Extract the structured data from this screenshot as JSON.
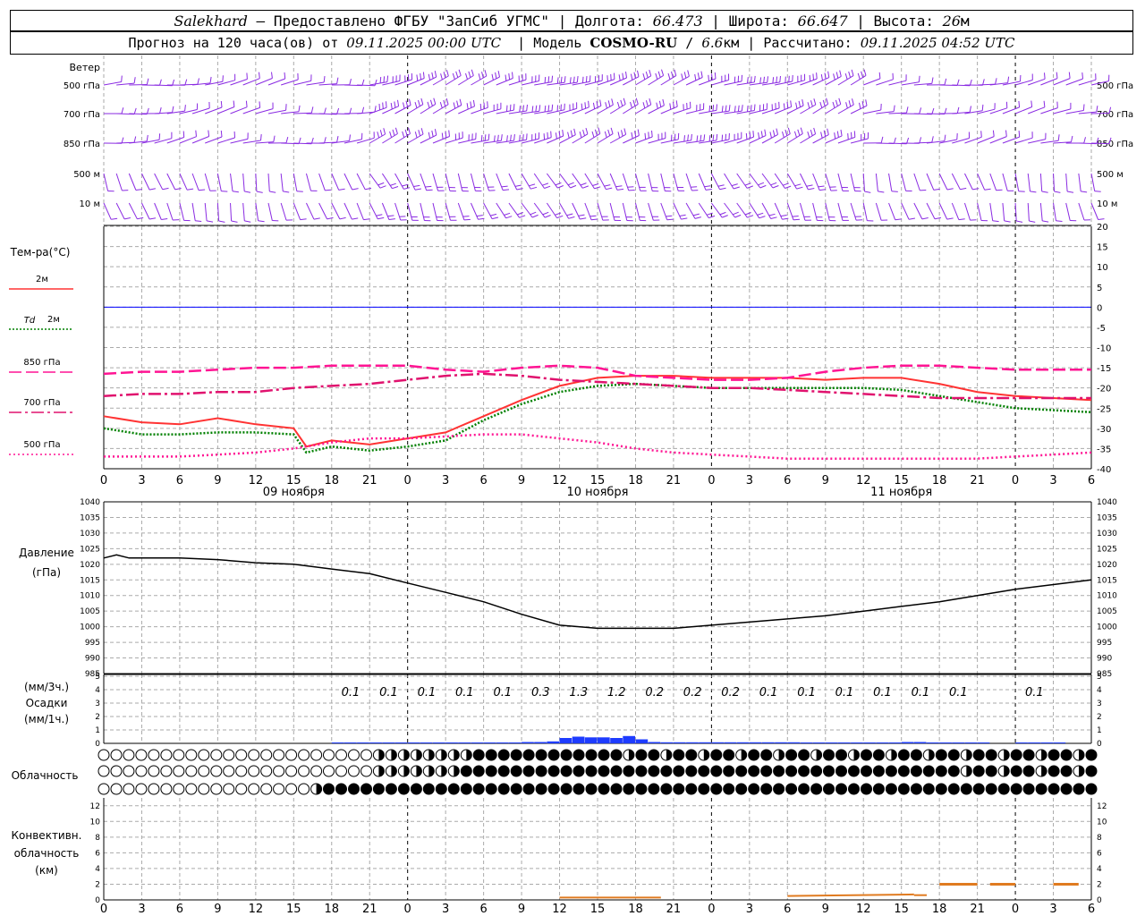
{
  "header": {
    "station": "Salekhard",
    "provider": "– Предоставлено ФГБУ \"ЗапСиб УГМС\"",
    "lon_label": "Долгота:",
    "lon_value": "66.473",
    "lat_label": "Широта:",
    "lat_value": "66.647",
    "alt_label": "Высота:",
    "alt_value": "26",
    "alt_unit": "м",
    "forecast_label": "Прогноз на 120 часа(ов) от",
    "forecast_start": "09.11.2025 00:00 UTC",
    "model_label": "Модель",
    "model_name": "COSMO-RU",
    "model_res": "6.6",
    "model_unit": "км",
    "calc_label": "Рассчитано:",
    "calc_time": "09.11.2025 04:52 UTC"
  },
  "colors": {
    "wind": "#8a2be2",
    "t2m": "#ff3333",
    "td2m": "#008000",
    "t850": "#ff1493",
    "t700": "#e0126e",
    "t500": "#ff1493",
    "zero_line": "#0000ff",
    "pressure": "#000000",
    "precip": "#1e3cff",
    "convective": "#e07b20",
    "grid": "#aaaaaa"
  },
  "chart_data": [
    {
      "type": "wind_barbs",
      "row_labels": [
        "Ветер",
        "500 гПа",
        "700 гПа",
        "850 гПа",
        "500 м",
        "10 м"
      ],
      "levels": [
        "500 гПа",
        "700 гПа",
        "850 гПа",
        "500 м",
        "10 м"
      ]
    },
    {
      "type": "line",
      "ylabel": "Тем-ра(°C)",
      "ylim": [
        -40,
        20
      ],
      "yticks": [
        -40,
        -35,
        -30,
        -25,
        -20,
        -15,
        -10,
        -5,
        0,
        5,
        10,
        15,
        20
      ],
      "xticks": [
        "0",
        "3",
        "6",
        "9",
        "12",
        "15",
        "18",
        "21",
        "0",
        "3",
        "6",
        "9",
        "12",
        "15",
        "18",
        "21",
        "0",
        "3",
        "6",
        "9",
        "12",
        "15",
        "18",
        "21",
        "0",
        "3",
        "6"
      ],
      "day_labels": [
        "09 ноября",
        "10 ноября",
        "11 ноября"
      ],
      "day_label_hours": [
        15,
        39,
        63
      ],
      "series": [
        {
          "name": "2м",
          "color": "#ff3333",
          "style": "solid",
          "x": [
            0,
            3,
            6,
            9,
            12,
            15,
            16,
            18,
            21,
            24,
            27,
            30,
            33,
            36,
            39,
            42,
            45,
            48,
            51,
            54,
            57,
            60,
            63,
            66,
            69,
            72,
            75,
            78
          ],
          "values": [
            -27,
            -28.5,
            -29,
            -27.5,
            -29,
            -30,
            -34.5,
            -33,
            -34,
            -32.5,
            -31,
            -27,
            -23,
            -19.5,
            -17.5,
            -17,
            -17,
            -17.5,
            -17.5,
            -17.5,
            -18,
            -17.5,
            -17.5,
            -19,
            -21,
            -22,
            -22.5,
            -23
          ]
        },
        {
          "name": "Td 2м",
          "color": "#008000",
          "style": "dotted",
          "x": [
            0,
            3,
            6,
            9,
            12,
            15,
            16,
            18,
            21,
            24,
            27,
            30,
            33,
            36,
            39,
            42,
            45,
            48,
            51,
            54,
            57,
            60,
            63,
            66,
            69,
            72,
            75,
            78
          ],
          "values": [
            -30,
            -31.5,
            -31.5,
            -31,
            -31,
            -31.5,
            -36,
            -34.5,
            -35.5,
            -34.5,
            -33,
            -28,
            -24,
            -21,
            -19.5,
            -19,
            -19.5,
            -20,
            -20,
            -20,
            -20,
            -20,
            -20.5,
            -22,
            -23.5,
            -25,
            -25.5,
            -26
          ]
        },
        {
          "name": "850 гПа",
          "color": "#ff1493",
          "style": "dash",
          "x": [
            0,
            3,
            6,
            9,
            12,
            15,
            18,
            21,
            24,
            27,
            30,
            33,
            36,
            39,
            42,
            45,
            48,
            51,
            54,
            57,
            60,
            63,
            66,
            69,
            72,
            75,
            78
          ],
          "values": [
            -16.5,
            -16,
            -16,
            -15.5,
            -15,
            -15,
            -14.5,
            -14.5,
            -14.5,
            -15.5,
            -16,
            -15,
            -14.5,
            -15,
            -17,
            -17.5,
            -18,
            -18,
            -17.5,
            -16,
            -15,
            -14.5,
            -14.5,
            -15,
            -15.5,
            -15.5,
            -15.5
          ]
        },
        {
          "name": "700 гПа",
          "color": "#e0126e",
          "style": "dashdot",
          "x": [
            0,
            3,
            6,
            9,
            12,
            15,
            18,
            21,
            24,
            27,
            30,
            33,
            36,
            39,
            42,
            45,
            48,
            51,
            54,
            57,
            60,
            63,
            66,
            69,
            72,
            75,
            78
          ],
          "values": [
            -22,
            -21.5,
            -21.5,
            -21,
            -21,
            -20,
            -19.5,
            -19,
            -18,
            -17,
            -16.5,
            -17,
            -18,
            -18.5,
            -19,
            -19.5,
            -20,
            -20,
            -20.5,
            -21,
            -21.5,
            -22,
            -22.5,
            -22.5,
            -22.5,
            -22.5,
            -22.5
          ]
        },
        {
          "name": "500 гПа",
          "color": "#ff1493",
          "style": "fine-dotted",
          "x": [
            0,
            3,
            6,
            9,
            12,
            15,
            18,
            21,
            24,
            27,
            30,
            33,
            36,
            39,
            42,
            45,
            48,
            51,
            54,
            57,
            60,
            63,
            66,
            69,
            72,
            75,
            78
          ],
          "values": [
            -37,
            -37,
            -37,
            -36.5,
            -36,
            -35,
            -33.5,
            -32.5,
            -32.5,
            -32,
            -31.5,
            -31.5,
            -32.5,
            -33.5,
            -35,
            -36,
            -36.5,
            -37,
            -37.5,
            -37.5,
            -37.5,
            -37.5,
            -37.5,
            -37.5,
            -37,
            -36.5,
            -36
          ]
        }
      ]
    },
    {
      "type": "line",
      "title": "Давление",
      "ylabel": "(гПа)",
      "ylim": [
        985,
        1040
      ],
      "yticks": [
        985,
        990,
        995,
        1000,
        1005,
        1010,
        1015,
        1020,
        1025,
        1030,
        1035,
        1040
      ],
      "series": [
        {
          "name": "Давление",
          "color": "#000000",
          "x": [
            0,
            1,
            2,
            6,
            9,
            12,
            15,
            18,
            21,
            24,
            27,
            30,
            33,
            36,
            39,
            42,
            45,
            48,
            51,
            54,
            57,
            60,
            63,
            66,
            69,
            72,
            75,
            78
          ],
          "values": [
            1022,
            1023,
            1022,
            1022,
            1021.5,
            1020.5,
            1020,
            1018.5,
            1017,
            1014,
            1011,
            1008,
            1004,
            1000.5,
            999.5,
            999.5,
            999.5,
            1000.5,
            1001.5,
            1002.5,
            1003.5,
            1005,
            1006.5,
            1008,
            1010,
            1012,
            1013.5,
            1015
          ]
        }
      ]
    },
    {
      "type": "bar",
      "ylabel_top": "(мм/3ч.)",
      "title": "Осадки",
      "ylabel_bottom": "(мм/1ч.)",
      "ylim": [
        0,
        5
      ],
      "yticks": [
        0,
        1,
        2,
        3,
        4,
        5
      ],
      "labels_3h": [
        {
          "hour": 19.5,
          "text": "0.1"
        },
        {
          "hour": 22.5,
          "text": "0.1"
        },
        {
          "hour": 25.5,
          "text": "0.1"
        },
        {
          "hour": 28.5,
          "text": "0.1"
        },
        {
          "hour": 31.5,
          "text": "0.1"
        },
        {
          "hour": 34.5,
          "text": "0.3"
        },
        {
          "hour": 37.5,
          "text": "1.3"
        },
        {
          "hour": 40.5,
          "text": "1.2"
        },
        {
          "hour": 43.5,
          "text": "0.2"
        },
        {
          "hour": 46.5,
          "text": "0.2"
        },
        {
          "hour": 49.5,
          "text": "0.2"
        },
        {
          "hour": 52.5,
          "text": "0.1"
        },
        {
          "hour": 55.5,
          "text": "0.1"
        },
        {
          "hour": 58.5,
          "text": "0.1"
        },
        {
          "hour": 61.5,
          "text": "0.1"
        },
        {
          "hour": 64.5,
          "text": "0.1"
        },
        {
          "hour": 67.5,
          "text": "0.1"
        },
        {
          "hour": 73.5,
          "text": "0.1"
        }
      ],
      "hourly": [
        {
          "hour": 18,
          "v": 0.05
        },
        {
          "hour": 19,
          "v": 0.05
        },
        {
          "hour": 20,
          "v": 0.05
        },
        {
          "hour": 21,
          "v": 0.05
        },
        {
          "hour": 22,
          "v": 0.05
        },
        {
          "hour": 23,
          "v": 0.05
        },
        {
          "hour": 24,
          "v": 0.05
        },
        {
          "hour": 25,
          "v": 0.05
        },
        {
          "hour": 26,
          "v": 0.05
        },
        {
          "hour": 27,
          "v": 0.05
        },
        {
          "hour": 28,
          "v": 0.05
        },
        {
          "hour": 29,
          "v": 0.05
        },
        {
          "hour": 30,
          "v": 0.05
        },
        {
          "hour": 31,
          "v": 0.05
        },
        {
          "hour": 32,
          "v": 0.05
        },
        {
          "hour": 33,
          "v": 0.1
        },
        {
          "hour": 34,
          "v": 0.1
        },
        {
          "hour": 35,
          "v": 0.15
        },
        {
          "hour": 36,
          "v": 0.4
        },
        {
          "hour": 37,
          "v": 0.5
        },
        {
          "hour": 38,
          "v": 0.45
        },
        {
          "hour": 39,
          "v": 0.45
        },
        {
          "hour": 40,
          "v": 0.4
        },
        {
          "hour": 41,
          "v": 0.55
        },
        {
          "hour": 42,
          "v": 0.3
        },
        {
          "hour": 43,
          "v": 0.1
        },
        {
          "hour": 44,
          "v": 0.08
        },
        {
          "hour": 45,
          "v": 0.08
        },
        {
          "hour": 46,
          "v": 0.08
        },
        {
          "hour": 47,
          "v": 0.08
        },
        {
          "hour": 48,
          "v": 0.08
        },
        {
          "hour": 49,
          "v": 0.08
        },
        {
          "hour": 50,
          "v": 0.08
        },
        {
          "hour": 51,
          "v": 0.08
        },
        {
          "hour": 52,
          "v": 0.08
        },
        {
          "hour": 53,
          "v": 0.08
        },
        {
          "hour": 54,
          "v": 0.08
        },
        {
          "hour": 55,
          "v": 0.05
        },
        {
          "hour": 56,
          "v": 0.05
        },
        {
          "hour": 57,
          "v": 0.05
        },
        {
          "hour": 58,
          "v": 0.05
        },
        {
          "hour": 59,
          "v": 0.05
        },
        {
          "hour": 60,
          "v": 0.05
        },
        {
          "hour": 61,
          "v": 0.05
        },
        {
          "hour": 62,
          "v": 0.05
        },
        {
          "hour": 63,
          "v": 0.1
        },
        {
          "hour": 64,
          "v": 0.1
        },
        {
          "hour": 65,
          "v": 0.05
        },
        {
          "hour": 66,
          "v": 0.05
        },
        {
          "hour": 67,
          "v": 0.05
        },
        {
          "hour": 68,
          "v": 0.05
        },
        {
          "hour": 69,
          "v": 0.05
        },
        {
          "hour": 72,
          "v": 0.05
        },
        {
          "hour": 73,
          "v": 0.05
        },
        {
          "hour": 74,
          "v": 0.05
        },
        {
          "hour": 75,
          "v": 0.05
        }
      ]
    },
    {
      "type": "cloud_symbols",
      "title": "Облачность",
      "rows": [
        {
          "level": "upper",
          "clear_until": 21,
          "partial_until": 29,
          "overcast_until": 40,
          "partial_until_2": 78
        },
        {
          "level": "middle",
          "clear_until": 21,
          "partial_until": 28,
          "overcast_until": 66,
          "partial_until_2": 77
        },
        {
          "level": "lower",
          "clear_until": 16,
          "partial_until": 17,
          "overcast_until": 78,
          "partial_until_2": 78
        }
      ]
    },
    {
      "type": "line",
      "title": "Конвективн. облачность (км)",
      "ylim": [
        0,
        13
      ],
      "yticks": [
        0,
        2,
        4,
        6,
        8,
        10,
        12
      ],
      "segments": [
        {
          "x": [
            36,
            44
          ],
          "values": [
            0.3,
            0.3
          ]
        },
        {
          "x": [
            54,
            64
          ],
          "values": [
            0.5,
            0.7
          ]
        },
        {
          "x": [
            64,
            65
          ],
          "values": [
            0.6,
            0.6
          ]
        },
        {
          "x": [
            66,
            69
          ],
          "values": [
            2,
            2
          ]
        },
        {
          "x": [
            70,
            72
          ],
          "values": [
            2,
            2
          ]
        },
        {
          "x": [
            75,
            77
          ],
          "values": [
            2,
            2
          ]
        }
      ]
    }
  ]
}
